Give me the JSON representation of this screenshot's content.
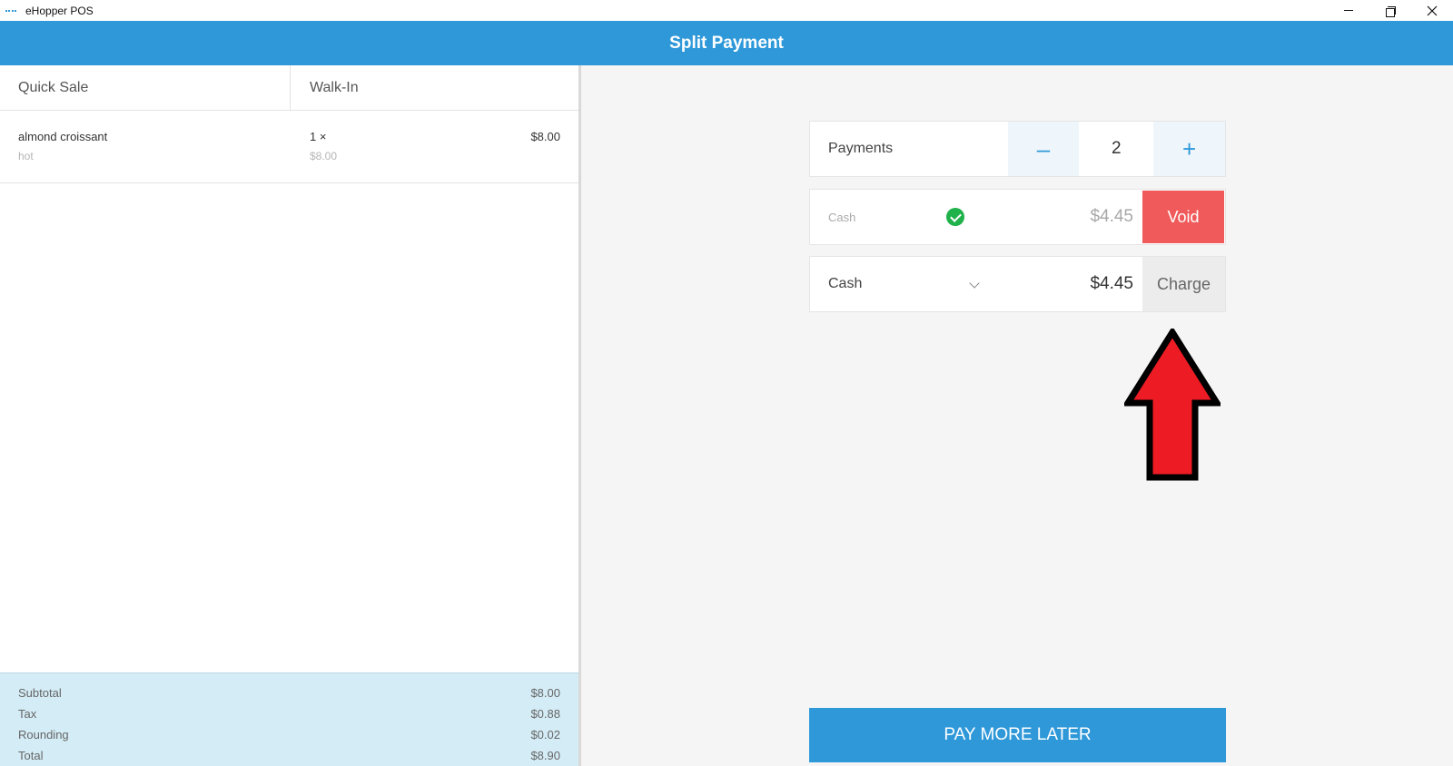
{
  "window": {
    "title": "eHopper POS"
  },
  "header": {
    "title": "Split Payment"
  },
  "ticket": {
    "customer_type": "Quick Sale",
    "customer_name": "Walk-In",
    "items": [
      {
        "name": "almond croissant",
        "modifier": "hot",
        "qty": "1 ×",
        "unit_price": "$8.00",
        "price": "$8.00"
      }
    ],
    "totals": [
      {
        "label": "Subtotal",
        "value": "$8.00"
      },
      {
        "label": "Tax",
        "value": "$0.88"
      },
      {
        "label": "Rounding",
        "value": "$0.02"
      },
      {
        "label": "Total",
        "value": "$8.90"
      }
    ]
  },
  "payments": {
    "label": "Payments",
    "count": "2",
    "minus": "–",
    "plus": "+"
  },
  "paid_payment": {
    "method": "Cash",
    "amount": "$4.45",
    "void_label": "Void",
    "status_icon": "check-circle-icon",
    "status_color": "#1fb14a"
  },
  "pending_payment": {
    "method": "Cash",
    "amount": "$4.45",
    "charge_label": "Charge"
  },
  "footer": {
    "pay_later_label": "PAY MORE LATER"
  },
  "colors": {
    "accent": "#2e98d9",
    "void": "#f05a5a",
    "totals_bg": "#d4ecf6"
  }
}
